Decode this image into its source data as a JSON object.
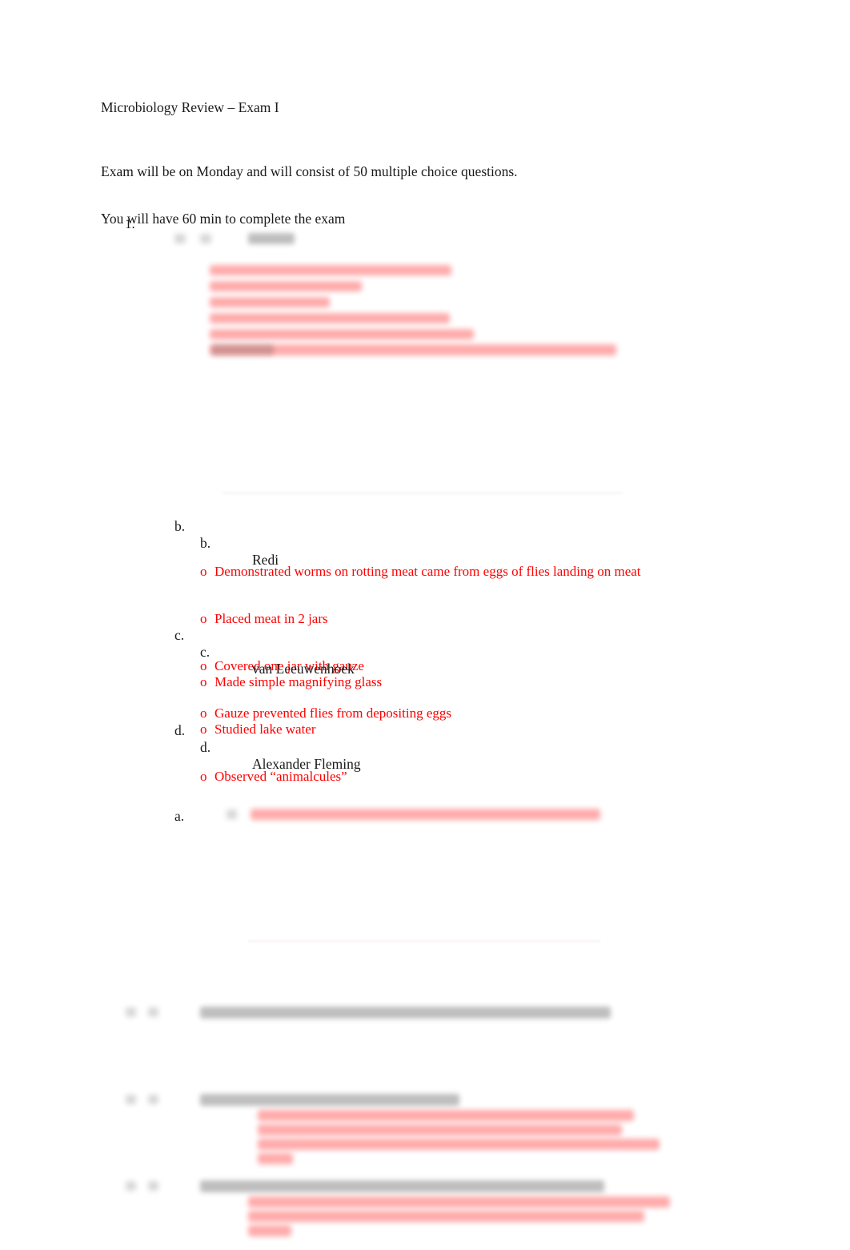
{
  "document": {
    "title": "Microbiology Review – Exam I",
    "intro_lines": [
      "Exam will be on Monday and will consist of 50 multiple choice questions.",
      "You will have 60 min to complete the exam"
    ]
  },
  "question_1": {
    "number": "1.",
    "items": [
      {
        "outer_marker": "a.",
        "inner_marker": "a.",
        "label": "",
        "legible": false,
        "note": "blurred / redacted"
      },
      {
        "outer_marker": "b.",
        "inner_marker": "b.",
        "label": "Redi",
        "legible": true,
        "bullet_marker": "o",
        "bullets": [
          "Demonstrated worms on rotting meat came from eggs of flies landing on meat",
          "Placed meat in 2 jars",
          "Covered one jar with gauze",
          "Gauze prevented flies from depositing eggs"
        ]
      },
      {
        "outer_marker": "c.",
        "inner_marker": "c.",
        "label": "van Leeuwenhoek",
        "legible": true,
        "bullet_marker": "o",
        "bullets": [
          "Made simple magnifying glass",
          "Studied lake water",
          "Observed “animalcules”"
        ]
      },
      {
        "outer_marker": "d.",
        "inner_marker": "d.",
        "label": "Alexander Fleming",
        "legible": true,
        "bullet_marker": "o",
        "bullets": []
      }
    ]
  },
  "question_2": {
    "outer_marker": "a.",
    "label": "",
    "legible": false,
    "note": "blurred / redacted"
  },
  "later_questions": [
    {
      "number": "",
      "text": "",
      "legible": false,
      "note": "blurred / redacted heading line"
    },
    {
      "number": "",
      "text": "",
      "legible": false,
      "note": "blurred / redacted heading with red answer block"
    },
    {
      "number": "",
      "text": "",
      "legible": false,
      "note": "blurred / redacted heading with red answer block"
    }
  ],
  "colors": {
    "body_text": "#1a1a1a",
    "answer_red": "#FF0000",
    "page_background": "#FFFFFF"
  }
}
